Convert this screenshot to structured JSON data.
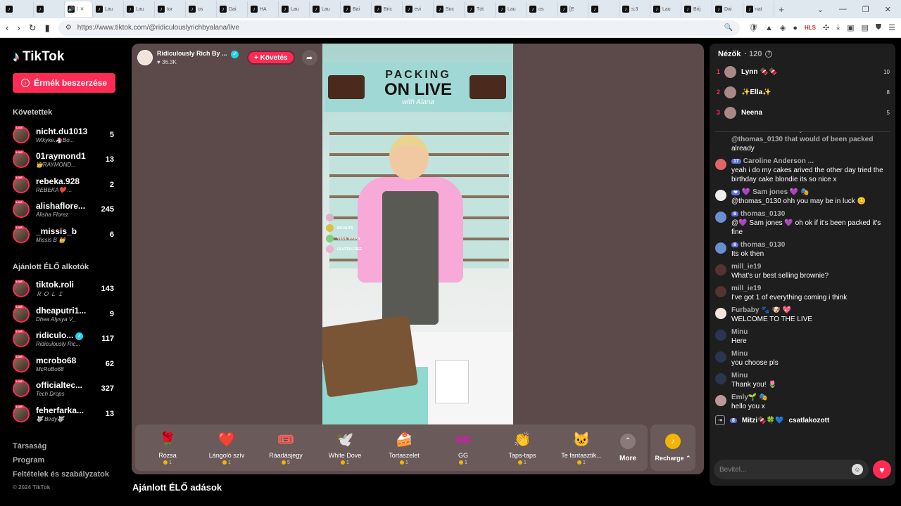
{
  "browser": {
    "tabs": [
      {
        "label": "",
        "icon": "tiktok-icon"
      },
      {
        "label": "",
        "icon": "tiktok-icon"
      },
      {
        "label": "l",
        "icon": "audio-icon",
        "active": true
      },
      {
        "label": "Lau",
        "icon": "tiktok-icon"
      },
      {
        "label": "Lau",
        "icon": "tiktok-icon"
      },
      {
        "label": "tor",
        "icon": "tiktok-icon"
      },
      {
        "label": "os",
        "icon": "tiktok-icon"
      },
      {
        "label": "Dai",
        "icon": "tiktok-icon"
      },
      {
        "label": "HA",
        "icon": "tiktok-icon"
      },
      {
        "label": "Lau",
        "icon": "tiktok-icon"
      },
      {
        "label": "Lau",
        "icon": "tiktok-icon"
      },
      {
        "label": "Bai",
        "icon": "tiktok-icon"
      },
      {
        "label": "Bric",
        "icon": "tiktok-icon"
      },
      {
        "label": "evi",
        "icon": "tiktok-icon"
      },
      {
        "label": "Soc",
        "icon": "tiktok-icon"
      },
      {
        "label": "Tót",
        "icon": "tiktok-icon"
      },
      {
        "label": "Lau",
        "icon": "tiktok-icon"
      },
      {
        "label": "os",
        "icon": "tiktok-icon"
      },
      {
        "label": "[E",
        "icon": "tiktok-icon"
      },
      {
        "label": "",
        "icon": "tiktok-icon"
      },
      {
        "label": "s:3",
        "icon": "tiktok-icon"
      },
      {
        "label": "Lau",
        "icon": "tiktok-icon"
      },
      {
        "label": "Brij",
        "icon": "tiktok-icon"
      },
      {
        "label": "Dai",
        "icon": "tiktok-icon"
      },
      {
        "label": "nat",
        "icon": "tiktok-icon"
      }
    ],
    "new_tab": "+",
    "url": "https://www.tiktok.com/@ridiculouslyrichbyalana/live",
    "ext_hls": "HLS"
  },
  "sidebar": {
    "brand": "TikTok",
    "coins_button": "Érmék beszerzése",
    "following_title": "Követettek",
    "following": [
      {
        "name": "nicht.du1013",
        "sub": "Wikyke.🦄Bo...",
        "count": "5"
      },
      {
        "name": "01raymond1",
        "sub": "👑RAYMOND...",
        "count": "13"
      },
      {
        "name": "rebeka.928",
        "sub": "REBEKA❤️ ...",
        "count": "2"
      },
      {
        "name": "alishaflore...",
        "sub": "Alisha Florez",
        "count": "245"
      },
      {
        "name": "_missis_b",
        "sub": "Missis B 👑",
        "count": "6"
      }
    ],
    "suggested_title": "Ajánlott ÉLŐ alkotók",
    "suggested": [
      {
        "name": "tiktok.roli",
        "sub": "Ｒ Ｏ Ｌ Ｉ",
        "count": "143"
      },
      {
        "name": "dheaputri1...",
        "sub": "Dhea Alysya V_",
        "count": "9"
      },
      {
        "name": "ridiculo...",
        "sub": "Ridiculously Ric...",
        "count": "117",
        "verified": true
      },
      {
        "name": "mcrobo68",
        "sub": "McRoBo68",
        "count": "62"
      },
      {
        "name": "officialtec...",
        "sub": "Tech Drops",
        "count": "327"
      },
      {
        "name": "feherfarka...",
        "sub": "🐺 Birdy🐺",
        "count": "13"
      }
    ],
    "live_badge": "LIVE",
    "footer": [
      "Társaság",
      "Program",
      "Feltételek és szabályzatok"
    ],
    "copyright": "© 2024 TikTok"
  },
  "stream": {
    "host_name": "Ridiculously Rich By ...",
    "host_likes": "36.3K",
    "follow_label": "+ Követés",
    "banner_top": "PACKING",
    "banner_main": "ON LIVE",
    "banner_script": "with Alana",
    "legend": [
      "NO NUTS",
      "VEGETARIAN",
      "GLUTEN FREE"
    ],
    "legend_colors": [
      "#e0b0c8",
      "#d8c040",
      "#7fd07f",
      "#f0b0d0"
    ]
  },
  "gifts": [
    {
      "name": "Rózsa",
      "price": "1",
      "icon": "🌹"
    },
    {
      "name": "Lángoló szív",
      "price": "1",
      "icon": "❤️"
    },
    {
      "name": "Ráadásjegy",
      "price": "5",
      "icon": "🎟️"
    },
    {
      "name": "White Dove",
      "price": "1",
      "icon": "🕊️"
    },
    {
      "name": "Tortaszelet",
      "price": "1",
      "icon": "🍰"
    },
    {
      "name": "GG",
      "price": "1",
      "icon": "GG"
    },
    {
      "name": "Taps-taps",
      "price": "1",
      "icon": "👏"
    },
    {
      "name": "Te fantasztik...",
      "price": "1",
      "icon": "🐱"
    }
  ],
  "gift_more": "More",
  "recharge": "Recharge ⌃",
  "suggested_live_title": "Ajánlott ÉLŐ adások",
  "chat": {
    "viewers_label": "Nézők",
    "viewers_count": "· 120",
    "top_viewers": [
      {
        "rank": "1",
        "name": "Lynn 🍫🍫",
        "score": "10"
      },
      {
        "rank": "2",
        "name": "✨Ella✨",
        "score": "8"
      },
      {
        "rank": "3",
        "name": "Neena",
        "score": "5"
      }
    ],
    "messages": [
      {
        "user": "@thomas_0130 that would of been packed",
        "badge": "",
        "text": "already"
      },
      {
        "user": "Caroline Anderson ...",
        "badge": "17",
        "text": "yeah i do my cakes arived the other day tried the birthday cake blondie its so nice x"
      },
      {
        "user": "💜 Sam jones 💜 🎭",
        "badge": "❤",
        "text": "@thomas_0130 ohh you may be in luck 😊"
      },
      {
        "user": "thomas_0130",
        "badge": "8",
        "text": "@💜 Sam jones 💜 oh ok if it's been packed it's fine"
      },
      {
        "user": "thomas_0130",
        "badge": "8",
        "text": "Its ok then"
      },
      {
        "user": "mill_ie19",
        "badge": "",
        "text": "What's ur best selling brownie?"
      },
      {
        "user": "mill_ie19",
        "badge": "",
        "text": "I've got 1 of everything coming i think"
      },
      {
        "user": "Furbaby 🐾 🐶 💖",
        "badge": "",
        "text": "WELCOME TO THE LIVE"
      },
      {
        "user": "Minu",
        "badge": "",
        "text": "Here"
      },
      {
        "user": "Minu",
        "badge": "",
        "text": "you choose pls"
      },
      {
        "user": "Minu",
        "badge": "",
        "text": "Thank you! 🌷"
      },
      {
        "user": "Emly🌱 🎭",
        "badge": "",
        "text": "hello you x"
      }
    ],
    "joined_user": "Mitzi🍫🍀💙",
    "joined_badge": "8",
    "joined_text": "csatlakozott",
    "input_placeholder": "Bevitel..."
  }
}
